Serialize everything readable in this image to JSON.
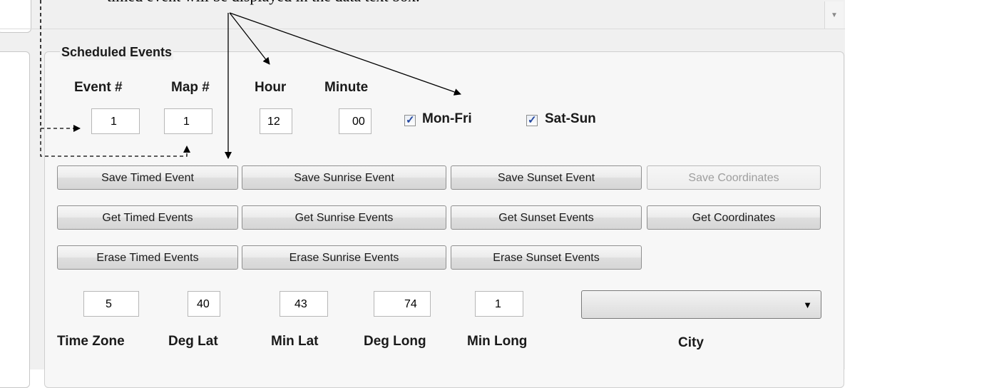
{
  "caption": "timed event will be displayed in the data text box.",
  "group": {
    "title": "Scheduled Events"
  },
  "event_row": {
    "labels": {
      "event": "Event #",
      "map": "Map #",
      "hour": "Hour",
      "minute": "Minute"
    },
    "values": {
      "event": "1",
      "map": "1",
      "hour": "12",
      "minute": "00"
    },
    "mon_fri": {
      "label": "Mon-Fri",
      "checked": true
    },
    "sat_sun": {
      "label": "Sat-Sun",
      "checked": true
    }
  },
  "buttons": {
    "save_timed": "Save Timed Event",
    "save_sunrise": "Save Sunrise Event",
    "save_sunset": "Save Sunset Event",
    "save_coords": "Save Coordinates",
    "get_timed": "Get Timed Events",
    "get_sunrise": "Get Sunrise Events",
    "get_sunset": "Get Sunset Events",
    "get_coords": "Get Coordinates",
    "erase_timed": "Erase Timed Events",
    "erase_sunrise": "Erase Sunrise Events",
    "erase_sunset": "Erase Sunset Events"
  },
  "location": {
    "values": {
      "time_zone": "5",
      "deg_lat": "40",
      "min_lat": "43",
      "deg_long": "74",
      "min_long": "1"
    },
    "labels": {
      "time_zone": "Time Zone",
      "deg_lat": "Deg Lat",
      "min_lat": "Min Lat",
      "deg_long": "Deg Long",
      "min_long": "Min Long",
      "city": "City"
    },
    "city_value": ""
  },
  "icons": {
    "checkbox_check": "check-icon",
    "combo_arrow": "dropdown-arrow-icon",
    "scroll_arrow": "scroll-down-arrow-icon"
  },
  "colors": {
    "check": "#24479e",
    "window_bg": "#f0f0f0"
  }
}
